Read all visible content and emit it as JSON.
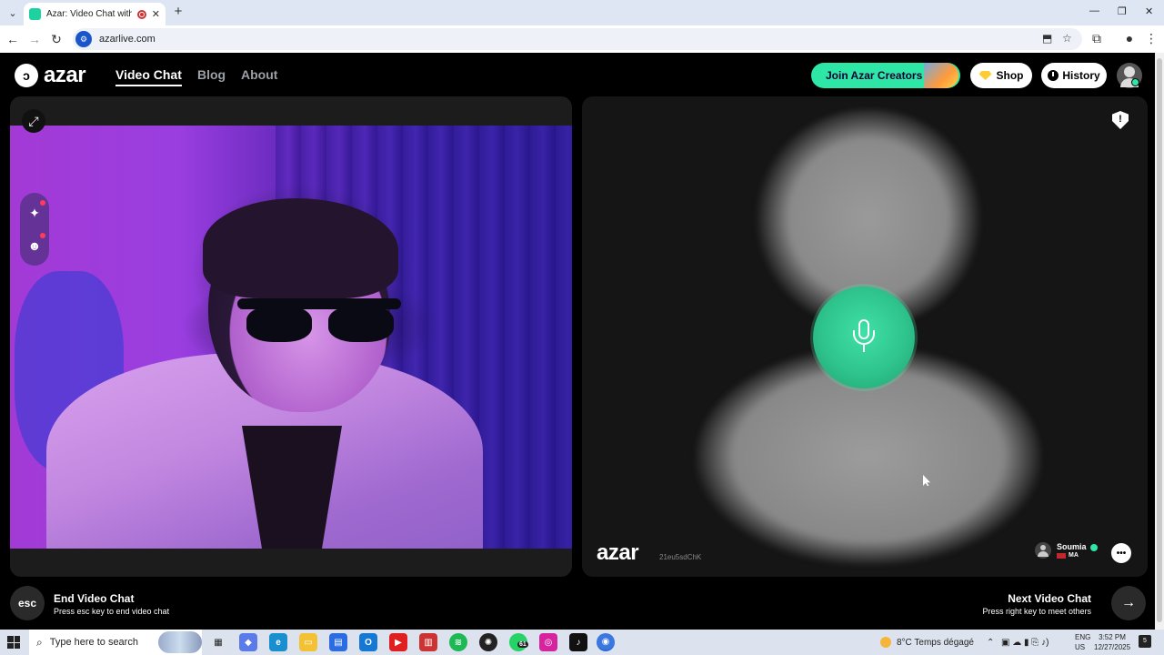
{
  "browser": {
    "tab_title": "Azar: Video Chat with New",
    "url": "azarlive.com",
    "new_tab_symbol": "+",
    "close_symbol": "✕",
    "window_controls": [
      "—",
      "❐",
      "✕"
    ]
  },
  "header": {
    "logo_text": "azar",
    "nav": [
      {
        "label": "Video Chat",
        "active": true
      },
      {
        "label": "Blog",
        "active": false
      },
      {
        "label": "About",
        "active": false
      }
    ],
    "join_creators_label": "Join Azar Creators",
    "shop_label": "Shop",
    "history_label": "History"
  },
  "partner": {
    "watermark": "azar",
    "room_code": "21eu5sdChK",
    "name": "Soumia",
    "country_code": "MA"
  },
  "footer": {
    "esc_key": "esc",
    "end_title": "End Video Chat",
    "end_subtitle": "Press esc key to end video chat",
    "next_title": "Next Video Chat",
    "next_subtitle": "Press right key to meet others",
    "next_arrow": "→"
  },
  "taskbar": {
    "search_placeholder": "Type here to search",
    "whatsapp_badge": "61",
    "weather": "8°C  Temps dégagé",
    "lang_line1": "ENG",
    "lang_line2": "US",
    "time": "3:52 PM",
    "date": "12/27/2025",
    "notification_count": "5"
  },
  "colors": {
    "accent_green": "#2ee6a6",
    "mic_green": "#2fc48d",
    "page_bg": "#000000"
  }
}
